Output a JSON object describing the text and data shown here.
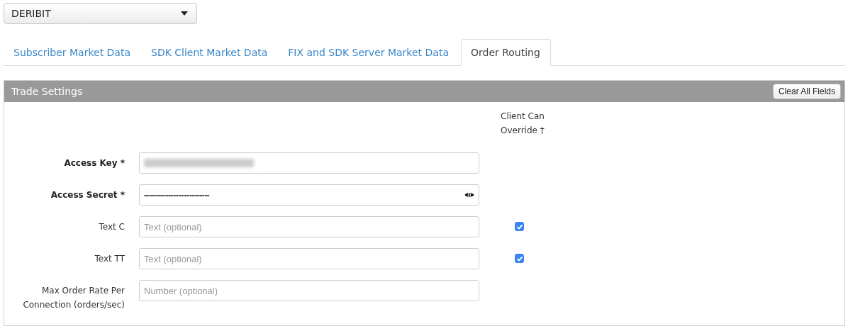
{
  "exchange_select": {
    "value": "DERIBIT"
  },
  "tabs": [
    {
      "label": "Subscriber Market Data",
      "selected": false
    },
    {
      "label": "SDK Client Market Data",
      "selected": false
    },
    {
      "label": "FIX and SDK Server Market Data",
      "selected": false
    },
    {
      "label": "Order Routing",
      "selected": true
    }
  ],
  "panel": {
    "title": "Trade Settings",
    "clear_button": "Clear All Fields",
    "override_header": "Client Can Override †",
    "fields": [
      {
        "label": "Access Key *",
        "required": true,
        "kind": "blurred"
      },
      {
        "label": "Access Secret *",
        "required": true,
        "kind": "password",
        "value": "••••••••••••••••••••••••••••••••••••••••"
      },
      {
        "label": "Text C",
        "required": false,
        "kind": "text",
        "placeholder": "Text (optional)",
        "override": true
      },
      {
        "label": "Text TT",
        "required": false,
        "kind": "text",
        "placeholder": "Text (optional)",
        "override": true
      },
      {
        "label": "Max Order Rate Per Connection (orders/sec)",
        "required": false,
        "kind": "text",
        "placeholder": "Number (optional)"
      }
    ]
  }
}
